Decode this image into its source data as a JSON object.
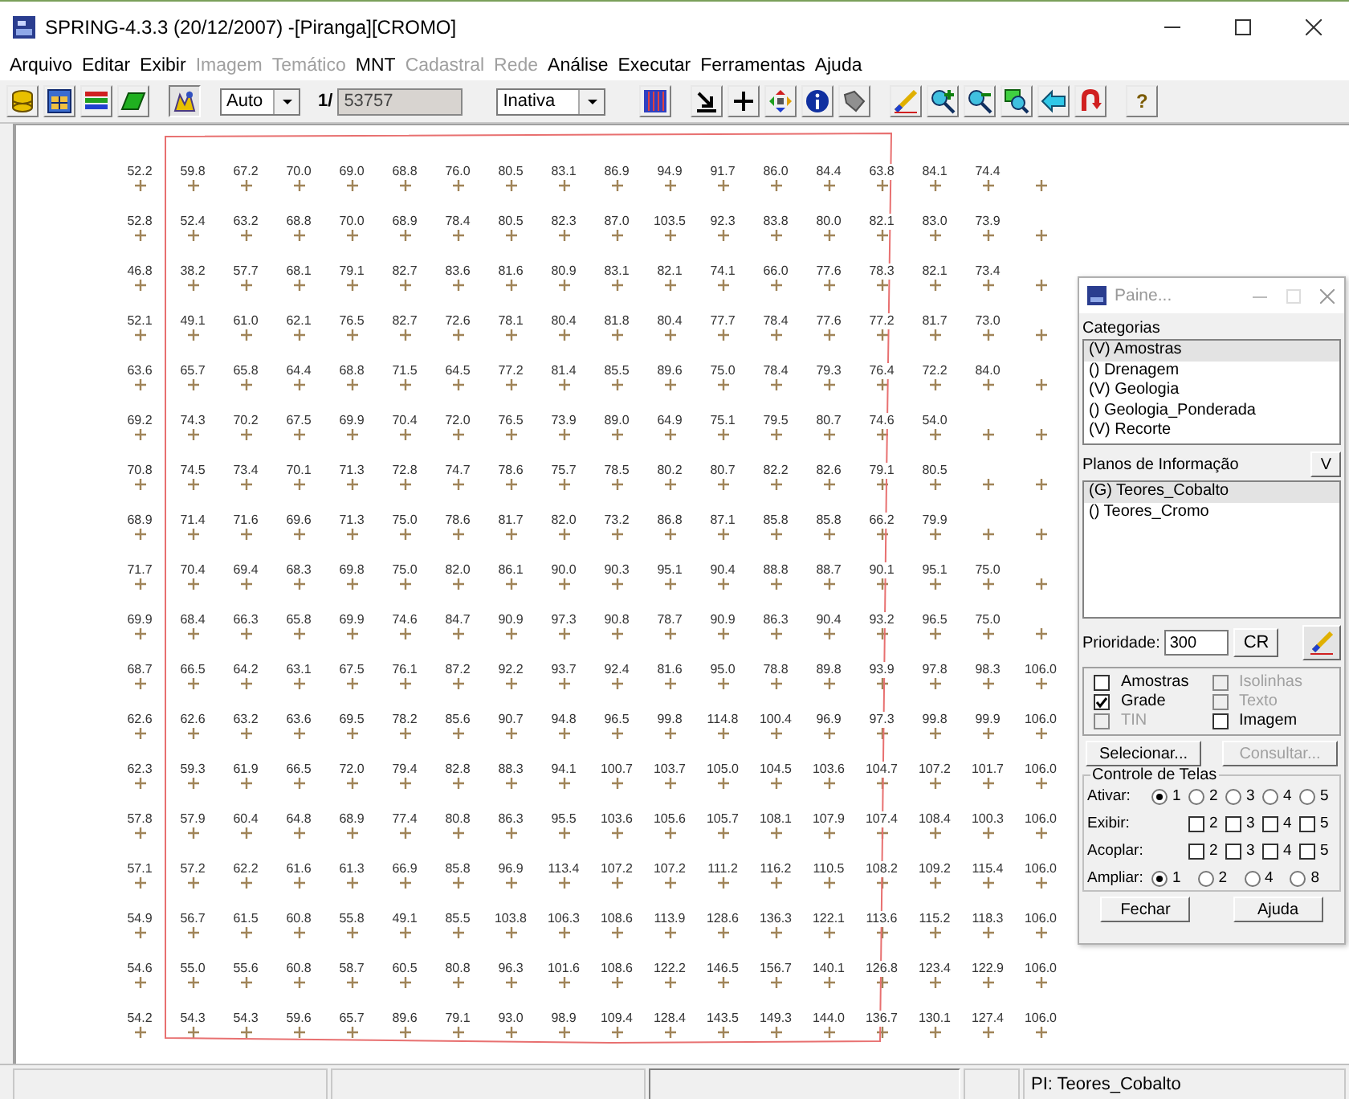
{
  "window": {
    "title": "SPRING-4.3.3 (20/12/2007) -[Piranga][CROMO]"
  },
  "menu": [
    {
      "label": "Arquivo",
      "disabled": false
    },
    {
      "label": "Editar",
      "disabled": false
    },
    {
      "label": "Exibir",
      "disabled": false
    },
    {
      "label": "Imagem",
      "disabled": true
    },
    {
      "label": "Temático",
      "disabled": true
    },
    {
      "label": "MNT",
      "disabled": false
    },
    {
      "label": "Cadastral",
      "disabled": true
    },
    {
      "label": "Rede",
      "disabled": true
    },
    {
      "label": "Análise",
      "disabled": false
    },
    {
      "label": "Executar",
      "disabled": false
    },
    {
      "label": "Ferramentas",
      "disabled": false
    },
    {
      "label": "Ajuda",
      "disabled": false
    }
  ],
  "toolbar": {
    "scale_mode": "Auto",
    "scale_prefix": "1/",
    "scale": "53757",
    "mode": "Inativa",
    "help": "?"
  },
  "canvas": {
    "rows": [
      [
        "52.2",
        "59.8",
        "67.2",
        "70.0",
        "69.0",
        "68.8",
        "76.0",
        "80.5",
        "83.1",
        "86.9",
        "94.9",
        "91.7",
        "86.0",
        "84.4",
        "63.8",
        "84.1",
        "74.4",
        null
      ],
      [
        "52.8",
        "52.4",
        "63.2",
        "68.8",
        "70.0",
        "68.9",
        "78.4",
        "80.5",
        "82.3",
        "87.0",
        "103.5",
        "92.3",
        "83.8",
        "80.0",
        "82.1",
        "83.0",
        "73.9",
        null
      ],
      [
        "46.8",
        "38.2",
        "57.7",
        "68.1",
        "79.1",
        "82.7",
        "83.6",
        "81.6",
        "80.9",
        "83.1",
        "82.1",
        "74.1",
        "66.0",
        "77.6",
        "78.3",
        "82.1",
        "73.4",
        null
      ],
      [
        "52.1",
        "49.1",
        "61.0",
        "62.1",
        "76.5",
        "82.7",
        "72.6",
        "78.1",
        "80.4",
        "81.8",
        "80.4",
        "77.7",
        "78.4",
        "77.6",
        "77.2",
        "81.7",
        "73.0",
        null
      ],
      [
        "63.6",
        "65.7",
        "65.8",
        "64.4",
        "68.8",
        "71.5",
        "64.5",
        "77.2",
        "81.4",
        "85.5",
        "89.6",
        "75.0",
        "78.4",
        "79.3",
        "76.4",
        "72.2",
        "84.0",
        null
      ],
      [
        "69.2",
        "74.3",
        "70.2",
        "67.5",
        "69.9",
        "70.4",
        "72.0",
        "76.5",
        "73.9",
        "89.0",
        "64.9",
        "75.1",
        "79.5",
        "80.7",
        "74.6",
        "54.0",
        null,
        null
      ],
      [
        "70.8",
        "74.5",
        "73.4",
        "70.1",
        "71.3",
        "72.8",
        "74.7",
        "78.6",
        "75.7",
        "78.5",
        "80.2",
        "80.7",
        "82.2",
        "82.6",
        "79.1",
        "80.5",
        null,
        null
      ],
      [
        "68.9",
        "71.4",
        "71.6",
        "69.6",
        "71.3",
        "75.0",
        "78.6",
        "81.7",
        "82.0",
        "73.2",
        "86.8",
        "87.1",
        "85.8",
        "85.8",
        "66.2",
        "79.9",
        null,
        null
      ],
      [
        "71.7",
        "70.4",
        "69.4",
        "68.3",
        "69.8",
        "75.0",
        "82.0",
        "86.1",
        "90.0",
        "90.3",
        "95.1",
        "90.4",
        "88.8",
        "88.7",
        "90.1",
        "95.1",
        "75.0",
        null
      ],
      [
        "69.9",
        "68.4",
        "66.3",
        "65.8",
        "69.9",
        "74.6",
        "84.7",
        "90.9",
        "97.3",
        "90.8",
        "78.7",
        "90.9",
        "86.3",
        "90.4",
        "93.2",
        "96.5",
        "75.0",
        null
      ],
      [
        "68.7",
        "66.5",
        "64.2",
        "63.1",
        "67.5",
        "76.1",
        "87.2",
        "92.2",
        "93.7",
        "92.4",
        "81.6",
        "95.0",
        "78.8",
        "89.8",
        "93.9",
        "97.8",
        "98.3",
        "106.0"
      ],
      [
        "62.6",
        "62.6",
        "63.2",
        "63.6",
        "69.5",
        "78.2",
        "85.6",
        "90.7",
        "94.8",
        "96.5",
        "99.8",
        "114.8",
        "100.4",
        "96.9",
        "97.3",
        "99.8",
        "99.9",
        "106.0"
      ],
      [
        "62.3",
        "59.3",
        "61.9",
        "66.5",
        "72.0",
        "79.4",
        "82.8",
        "88.3",
        "94.1",
        "100.7",
        "103.7",
        "105.0",
        "104.5",
        "103.6",
        "104.7",
        "107.2",
        "101.7",
        "106.0"
      ],
      [
        "57.8",
        "57.9",
        "60.4",
        "64.8",
        "68.9",
        "77.4",
        "80.8",
        "86.3",
        "95.5",
        "103.6",
        "105.6",
        "105.7",
        "108.1",
        "107.9",
        "107.4",
        "108.4",
        "100.3",
        "106.0"
      ],
      [
        "57.1",
        "57.2",
        "62.2",
        "61.6",
        "61.3",
        "66.9",
        "85.8",
        "96.9",
        "113.4",
        "107.2",
        "107.2",
        "111.2",
        "116.2",
        "110.5",
        "108.2",
        "109.2",
        "115.4",
        "106.0"
      ],
      [
        "54.9",
        "56.7",
        "61.5",
        "60.8",
        "55.8",
        "49.1",
        "85.5",
        "103.8",
        "106.3",
        "108.6",
        "113.9",
        "128.6",
        "136.3",
        "122.1",
        "113.6",
        "115.2",
        "118.3",
        "106.0"
      ],
      [
        "54.6",
        "55.0",
        "55.6",
        "60.8",
        "58.7",
        "60.5",
        "80.8",
        "96.3",
        "101.6",
        "108.6",
        "122.2",
        "146.5",
        "156.7",
        "140.1",
        "126.8",
        "123.4",
        "122.9",
        "106.0"
      ],
      [
        "54.2",
        "54.3",
        "54.3",
        "59.6",
        "65.7",
        "89.6",
        "79.1",
        "93.0",
        "98.9",
        "109.4",
        "128.4",
        "143.5",
        "149.3",
        "144.0",
        "136.7",
        "130.1",
        "127.4",
        "106.0"
      ]
    ]
  },
  "panel": {
    "title": "Paine...",
    "categories_label": "Categorias",
    "categories": [
      {
        "label": "(V) Amostras",
        "selected": true
      },
      {
        "label": "() Drenagem",
        "selected": false
      },
      {
        "label": "(V) Geologia",
        "selected": false
      },
      {
        "label": "() Geologia_Ponderada",
        "selected": false
      },
      {
        "label": "(V) Recorte",
        "selected": false
      }
    ],
    "planes_label": "Planos de Informação",
    "planes_button": "V",
    "planes": [
      {
        "label": "(G) Teores_Cobalto",
        "selected": true
      },
      {
        "label": "() Teores_Cromo",
        "selected": false
      }
    ],
    "priority_label": "Prioridade:",
    "priority": "300",
    "cr_button": "CR",
    "representations": [
      {
        "label": "Amostras",
        "checked": false,
        "disabled": false
      },
      {
        "label": "Isolinhas",
        "checked": false,
        "disabled": true
      },
      {
        "label": "Grade",
        "checked": true,
        "disabled": false
      },
      {
        "label": "Texto",
        "checked": false,
        "disabled": true
      },
      {
        "label": "TIN",
        "checked": false,
        "disabled": true
      },
      {
        "label": "Imagem",
        "checked": false,
        "disabled": false
      }
    ],
    "buttons": [
      {
        "label": "Selecionar...",
        "disabled": false
      },
      {
        "label": "Consultar...",
        "disabled": true
      }
    ],
    "screens": {
      "title": "Controle de Telas",
      "rows": [
        {
          "label": "Ativar:",
          "kind": "radio",
          "options": [
            {
              "label": "1",
              "selected": true
            },
            {
              "label": "2",
              "selected": false
            },
            {
              "label": "3",
              "selected": false
            },
            {
              "label": "4",
              "selected": false
            },
            {
              "label": "5",
              "selected": false
            }
          ]
        },
        {
          "label": "Exibir:",
          "kind": "checkbox",
          "options": [
            {
              "label": "2",
              "checked": false
            },
            {
              "label": "3",
              "checked": false
            },
            {
              "label": "4",
              "checked": false
            },
            {
              "label": "5",
              "checked": false
            }
          ]
        },
        {
          "label": "Acoplar:",
          "kind": "checkbox",
          "options": [
            {
              "label": "2",
              "checked": false
            },
            {
              "label": "3",
              "checked": false
            },
            {
              "label": "4",
              "checked": false
            },
            {
              "label": "5",
              "checked": false
            }
          ]
        },
        {
          "label": "Ampliar:",
          "kind": "radio",
          "options": [
            {
              "label": "1",
              "selected": true
            },
            {
              "label": "2",
              "selected": false
            },
            {
              "label": "4",
              "selected": false
            },
            {
              "label": "8",
              "selected": false
            }
          ]
        }
      ]
    },
    "footer_buttons": [
      "Fechar",
      "Ajuda"
    ]
  },
  "status_bar": {
    "plane": "PI: Teores_Cobalto"
  }
}
